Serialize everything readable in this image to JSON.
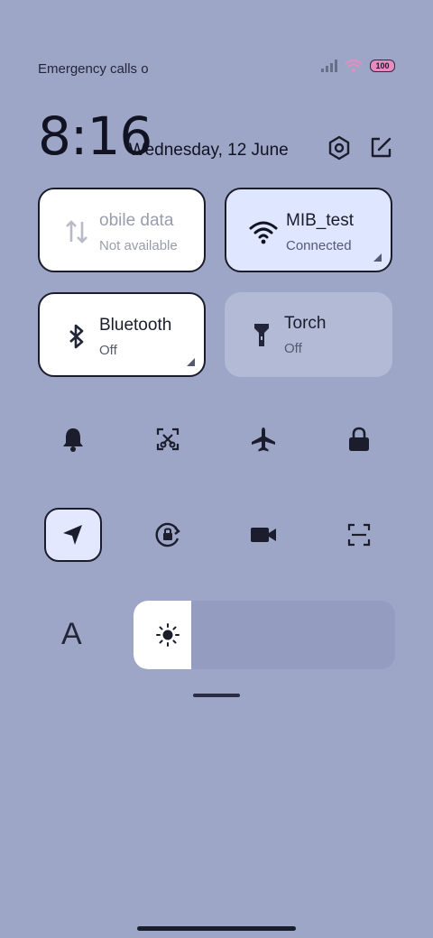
{
  "status_bar": {
    "carrier_text": "Emergency calls o",
    "battery_level": "100",
    "signal_icon": "cell-signal-icon",
    "wifi_icon": "wifi-icon"
  },
  "header": {
    "time": "8:16",
    "date": "Wednesday, 12 June"
  },
  "tiles": [
    {
      "name": "obile data",
      "status": "Not available",
      "icon": "mobile-data-icon",
      "state": "unavailable"
    },
    {
      "name": "MIB_test",
      "status": "Connected",
      "icon": "wifi-icon",
      "state": "on"
    },
    {
      "name": "Bluetooth",
      "status": "Off",
      "icon": "bluetooth-icon",
      "state": "off"
    },
    {
      "name": "Torch",
      "status": "Off",
      "icon": "torch-icon",
      "state": "off"
    }
  ],
  "toggles_row1": [
    "bell-icon",
    "screenshot-icon",
    "airplane-icon",
    "lock-icon"
  ],
  "toggles_row2": [
    "location-icon",
    "rotation-lock-icon",
    "screen-record-icon",
    "scanner-icon"
  ],
  "font_slider": {
    "letter": "A"
  },
  "brightness": {
    "level": 0.22
  },
  "colors": {
    "background": "#9da6c6",
    "active_tile": "#dfe6ff",
    "tile_border": "#1b1d2c"
  }
}
